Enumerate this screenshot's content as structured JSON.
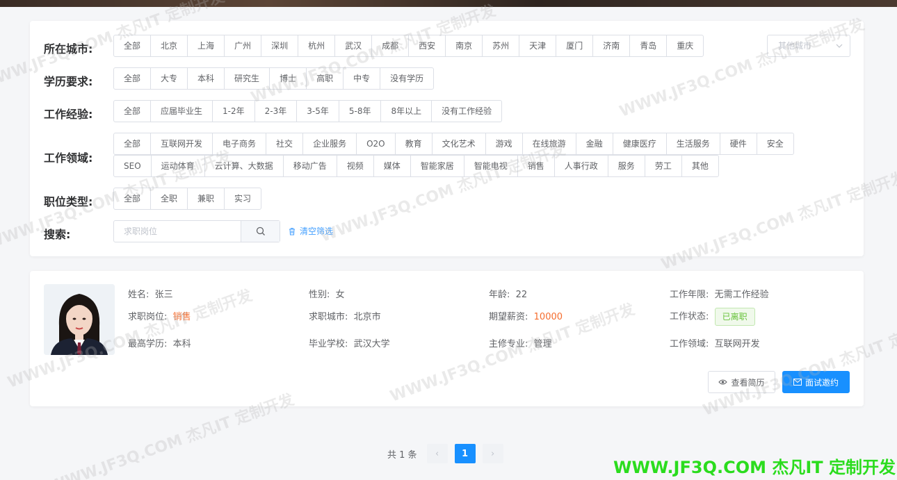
{
  "filters": {
    "city": {
      "label": "所在城市:",
      "options": [
        "全部",
        "北京",
        "上海",
        "广州",
        "深圳",
        "杭州",
        "武汉",
        "成都",
        "西安",
        "南京",
        "苏州",
        "天津",
        "厦门",
        "济南",
        "青岛",
        "重庆"
      ],
      "other_placeholder": "其他城市"
    },
    "education": {
      "label": "学历要求:",
      "options": [
        "全部",
        "大专",
        "本科",
        "研究生",
        "博士",
        "高职",
        "中专",
        "没有学历"
      ]
    },
    "experience": {
      "label": "工作经验:",
      "options": [
        "全部",
        "应届毕业生",
        "1-2年",
        "2-3年",
        "3-5年",
        "5-8年",
        "8年以上",
        "没有工作经验"
      ]
    },
    "field": {
      "label": "工作领域:",
      "options_row1": [
        "全部",
        "互联网开发",
        "电子商务",
        "社交",
        "企业服务",
        "O2O",
        "教育",
        "文化艺术",
        "游戏",
        "在线旅游",
        "金融",
        "健康医疗",
        "生活服务",
        "硬件",
        "安全"
      ],
      "options_row2": [
        "SEO",
        "运动体育",
        "云计算、大数据",
        "移动广告",
        "视频",
        "媒体",
        "智能家居",
        "智能电视",
        "销售",
        "人事行政",
        "服务",
        "劳工",
        "其他"
      ]
    },
    "job_type": {
      "label": "职位类型:",
      "options": [
        "全部",
        "全职",
        "兼职",
        "实习"
      ]
    },
    "search": {
      "label": "搜索:",
      "placeholder": "求职岗位",
      "clear_label": "清空筛选"
    }
  },
  "candidate": {
    "name_label": "姓名:",
    "name": "张三",
    "gender_label": "性别:",
    "gender": "女",
    "age_label": "年龄:",
    "age": "22",
    "years_label": "工作年限:",
    "years": "无需工作经验",
    "position_label": "求职岗位:",
    "position": "销售",
    "city_label": "求职城市:",
    "city": "北京市",
    "salary_label": "期望薪资:",
    "salary": "10000",
    "status_label": "工作状态:",
    "status": "已离职",
    "edu_label": "最高学历:",
    "edu": "本科",
    "school_label": "毕业学校:",
    "school": "武汉大学",
    "major_label": "主修专业:",
    "major": "管理",
    "field_label": "工作领域:",
    "field": "互联网开发",
    "view_button": "查看简历",
    "invite_button": "面试邀约"
  },
  "pagination": {
    "total_text": "共 1 条",
    "current_page": "1"
  },
  "watermark": {
    "text": "WWW.JF3Q.COM 杰凡IT 定制开发",
    "footer_text": "WWW.JF3Q.COM 杰凡IT  定制开发",
    "footer_color": "#2bdc1e"
  },
  "colors": {
    "accent": "#1890ff",
    "highlight": "#f56c2d",
    "status_green": "#67c23a"
  }
}
